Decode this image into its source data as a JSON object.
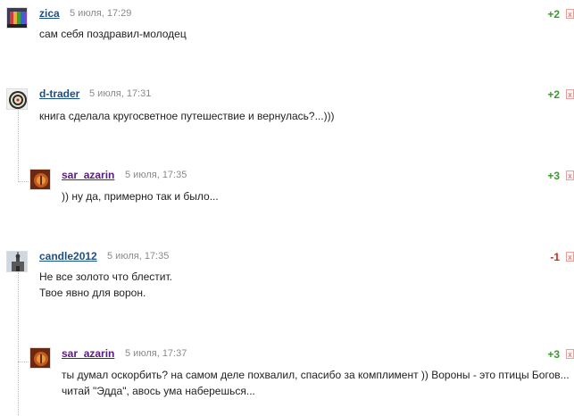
{
  "comments": [
    {
      "author": "zica",
      "date": "5 июля, 17:29",
      "score": "+2",
      "text": "сам себя поздравил-молодец",
      "close": "x"
    },
    {
      "author": "d-trader",
      "date": "5 июля, 17:31",
      "score": "+2",
      "text": "книга сделала кругосветное путешествие и вернулась?...)))",
      "close": "x"
    },
    {
      "author": "sar_azarin",
      "date": "5 июля, 17:35",
      "score": "+3",
      "text": ")) ну да, примерно так и было...",
      "close": "x"
    },
    {
      "author": "candle2012",
      "date": "5 июля, 17:35",
      "score": "-1",
      "text": "Не все золото что блестит.\nТвое явно для ворон.",
      "close": "x"
    },
    {
      "author": "sar_azarin",
      "date": "5 июля, 17:37",
      "score": "+3",
      "text": "ты думал оскорбить? на самом деле похвалил, спасибо за комплимент )) Вороны - это птицы Богов...\nчитай \"Эдда\", авось ума наберешься...",
      "close": "x"
    }
  ],
  "colors": {
    "author_link": "#1a4f8c",
    "reply_author_link": "#5a1a7a",
    "score_positive": "#3a9a2a",
    "score_negative": "#cc2a1a",
    "date": "#8a8a8a"
  },
  "icons": {
    "avatar_zica": "avatar-flag-icon",
    "avatar_dtrader": "avatar-dartboard-icon",
    "avatar_sar_azarin": "avatar-emblem-icon",
    "avatar_candle2012": "avatar-church-icon",
    "close": "close-icon"
  }
}
